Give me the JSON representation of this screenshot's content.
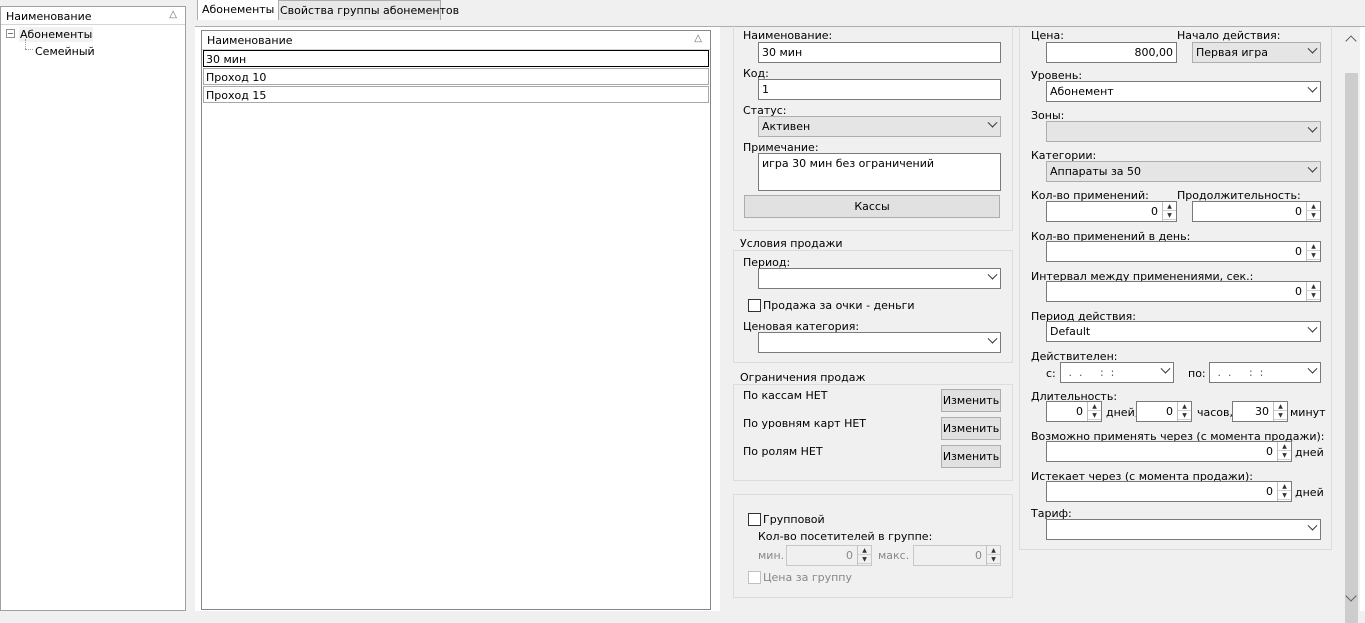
{
  "tree": {
    "header": "Наименование",
    "root": "Абонементы",
    "child": "Семейный"
  },
  "tabs": [
    "Абонементы",
    "Свойства группы абонементов"
  ],
  "list": {
    "header": "Наименование",
    "rows": [
      "30 мин",
      "Проход 10",
      "Проход 15"
    ]
  },
  "form": {
    "name_label": "Наименование:",
    "name_value": "30 мин",
    "code_label": "Код:",
    "code_value": "1",
    "status_label": "Статус:",
    "status_value": "Активен",
    "note_label": "Примечание:",
    "note_value": "игра 30 мин без ограничений",
    "kassy_button": "Кассы",
    "sale_conditions": {
      "title": "Условия продажи",
      "period_label": "Период:",
      "period_value": "",
      "points_checkbox": "Продажа за очки - деньги",
      "price_category_label": "Ценовая категория:",
      "price_category_value": ""
    },
    "sale_restrictions": {
      "title": "Ограничения продаж",
      "by_kassy": "По кассам НЕТ",
      "by_card_levels": "По уровням карт НЕТ",
      "by_roles": "По ролям НЕТ",
      "change_button": "Изменить"
    },
    "group": {
      "group_checkbox": "Групповой",
      "visitors_label": "Кол-во посетителей в группе:",
      "min_label": "мин.",
      "min_value": "0",
      "max_label": "макс.",
      "max_value": "0",
      "group_price": "Цена за группу"
    },
    "right": {
      "price_label": "Цена:",
      "price_value": "800,00",
      "start_label": "Начало действия:",
      "start_value": "Первая игра",
      "level_label": "Уровень:",
      "level_value": "Абонемент",
      "zones_label": "Зоны:",
      "zones_value": "",
      "categories_label": "Категории:",
      "categories_value": "Аппараты за 50",
      "uses_label": "Кол-во применений:",
      "uses_value": "0",
      "duration_label": "Продолжительность:",
      "duration_value": "0",
      "uses_per_day_label": "Кол-во применений в день:",
      "uses_per_day_value": "0",
      "interval_label": "Интервал между применениями, сек.:",
      "interval_value": "0",
      "period_label": "Период действия:",
      "period_value": "Default",
      "valid_label": "Действителен:",
      "from_label": "с:",
      "to_label": "по:",
      "date_mask": " .  .     :  :",
      "length_label": "Длительность:",
      "days_value": "0",
      "days_unit": "дней,",
      "hours_value": "0",
      "hours_unit": "часов,",
      "minutes_value": "30",
      "minutes_unit": "минут",
      "apply_after_label": "Возможно применять через (с момента продажи):",
      "apply_after_value": "0",
      "apply_after_unit": "дней",
      "expires_label": "Истекает через (с момента продажи):",
      "expires_value": "0",
      "expires_unit": "дней",
      "tariff_label": "Тариф:",
      "tariff_value": ""
    }
  }
}
